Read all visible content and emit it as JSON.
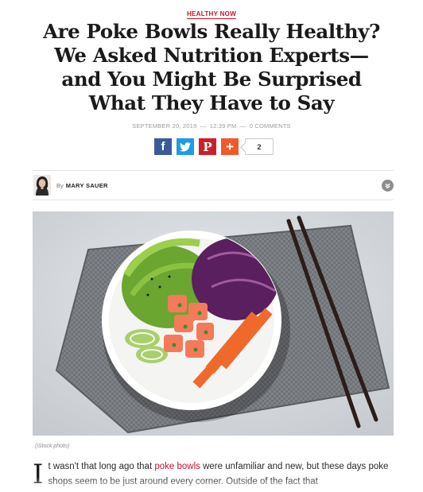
{
  "article": {
    "category": "HEALTHY NOW",
    "title_lines": [
      "Are Poke Bowls Really Healthy?",
      "We Asked Nutrition Experts—",
      "and You Might Be Surprised",
      "What They Have to Say"
    ],
    "date": "SEPTEMBER 20, 2019",
    "time": "12:39 PM",
    "comments": "0 COMMENTS",
    "date_time_sep": "—",
    "time_comments_sep": "—"
  },
  "share": {
    "facebook_glyph": "f",
    "pinterest_glyph": "P",
    "more_glyph": "+",
    "count": "2",
    "icons": [
      "facebook-icon",
      "twitter-icon",
      "pinterest-icon",
      "plus-icon"
    ]
  },
  "byline": {
    "by": "By",
    "author": "MARY SAUER",
    "expand_icon": "chevron-down-icon"
  },
  "photo": {
    "caption": "(iStock photo)"
  },
  "body": {
    "dropcap": "I",
    "text_before_link": "t wasn't that long ago that ",
    "link_text": "poke bowls",
    "text_after_link": " were unfamiliar and new, but these days poke shops seem to be just around every corner. Outside of the fact that"
  },
  "colors": {
    "accent": "#d0112b",
    "facebook": "#3b5a9a",
    "twitter": "#1c9ce6",
    "pinterest": "#cb2027",
    "share_more": "#f05a28"
  }
}
